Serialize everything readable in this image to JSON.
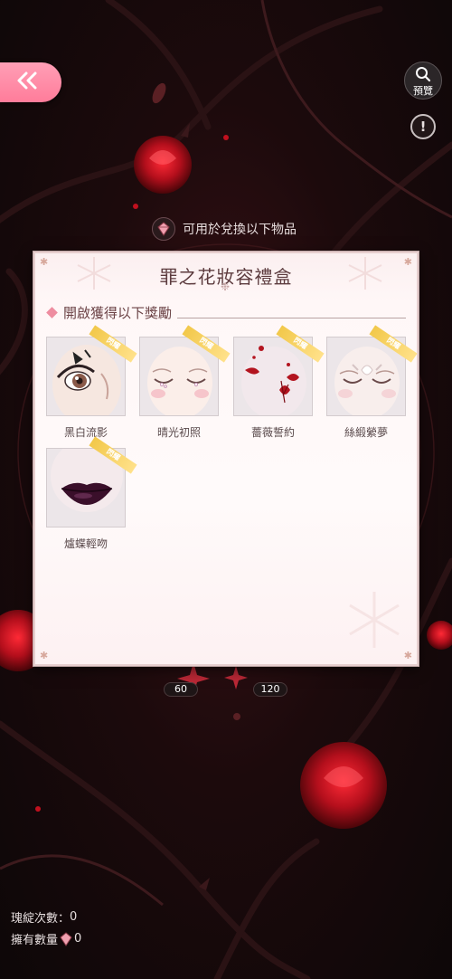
{
  "header": {
    "back_icon": "double-chevron-left-icon",
    "preview_label": "預覽",
    "preview_icon": "magnifier-icon",
    "info_icon": "exclamation-icon",
    "info_glyph": "!"
  },
  "exchange_hint": {
    "text": "可用於兌換以下物品",
    "icon": "gem-icon"
  },
  "panel": {
    "title": "罪之花妝容禮盒",
    "section_title": "開啟獲得以下獎勵",
    "items": [
      {
        "name": "黑白流影",
        "tag": "閃耀"
      },
      {
        "name": "晴光初照",
        "tag": "閃耀"
      },
      {
        "name": "薔薇誓約",
        "tag": "閃耀"
      },
      {
        "name": "絲緞縈夢",
        "tag": "閃耀"
      },
      {
        "name": "爐蝶輕吻",
        "tag": "閃耀"
      }
    ]
  },
  "costs": [
    "60",
    "120"
  ],
  "footer": {
    "draw_count_label": "瑰綻次數：",
    "draw_count_value": "0",
    "own_count_label": "擁有數量",
    "own_count_value": "0"
  },
  "colors": {
    "accent_pink": "#ff7c9a",
    "panel_bg": "#fff7f7",
    "tag_gold": "#f2c84a",
    "title_text": "#5c3b3e"
  }
}
